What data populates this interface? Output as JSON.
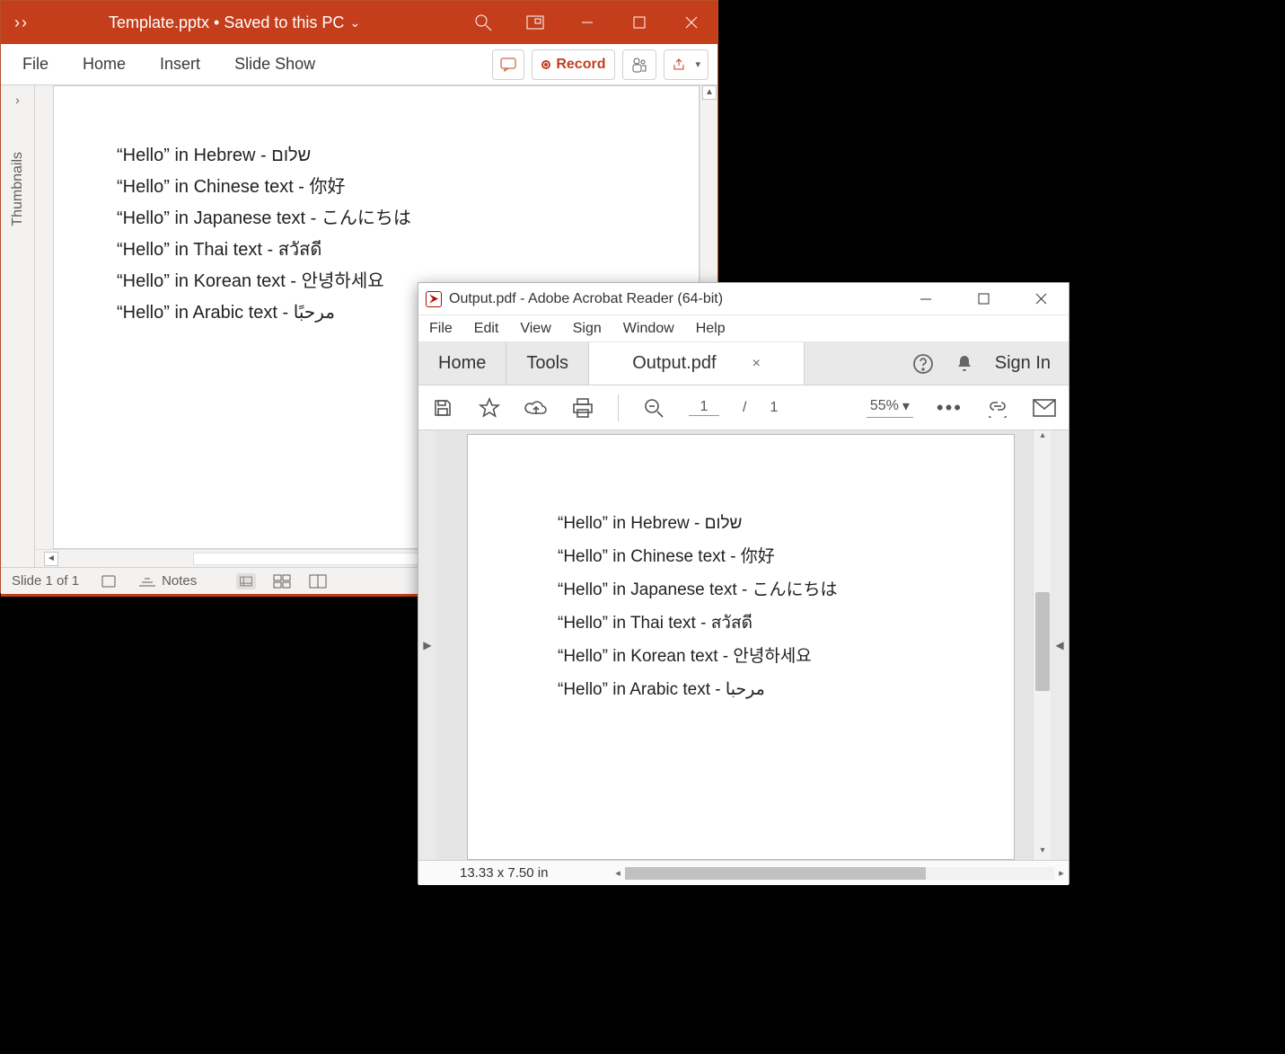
{
  "powerpoint": {
    "overflow_glyph": "››",
    "title": "Template.pptx • Saved to this PC",
    "title_chevron": "⌄",
    "tabs": {
      "file": "File",
      "home": "Home",
      "insert": "Insert",
      "slideshow": "Slide Show"
    },
    "record_label": "Record",
    "thumbnails_label": "Thumbnails",
    "expand_glyph": "›",
    "slide_lines": [
      "“Hello” in Hebrew - שלום",
      "“Hello” in Chinese text - 你好",
      "“Hello” in Japanese text - こんにちは",
      "“Hello” in Thai text - สวัสดี",
      "“Hello” in Korean text - 안녕하세요",
      "“Hello” in Arabic text - مرحبًا"
    ],
    "status": {
      "slide": "Slide 1 of 1",
      "notes": "Notes"
    }
  },
  "acrobat": {
    "title": "Output.pdf - Adobe Acrobat Reader (64-bit)",
    "menu": {
      "file": "File",
      "edit": "Edit",
      "view": "View",
      "sign": "Sign",
      "window": "Window",
      "help": "Help"
    },
    "tabs": {
      "home": "Home",
      "tools": "Tools",
      "doc": "Output.pdf",
      "close": "×"
    },
    "signin": "Sign In",
    "toolbar": {
      "page_current": "1",
      "page_sep": "/",
      "page_total": "1",
      "zoom": "55%",
      "zoom_chev": "▾",
      "dots": "•••"
    },
    "page_lines": [
      "“Hello” in Hebrew - שלום",
      "“Hello” in Chinese text - 你好",
      "“Hello” in Japanese text - こんにちは",
      "“Hello” in Thai text - สวัสดี",
      "“Hello” in Korean text - 안녕하세요",
      "“Hello” in Arabic text - مرحبا"
    ],
    "status": {
      "dims": "13.33 x 7.50 in"
    }
  }
}
